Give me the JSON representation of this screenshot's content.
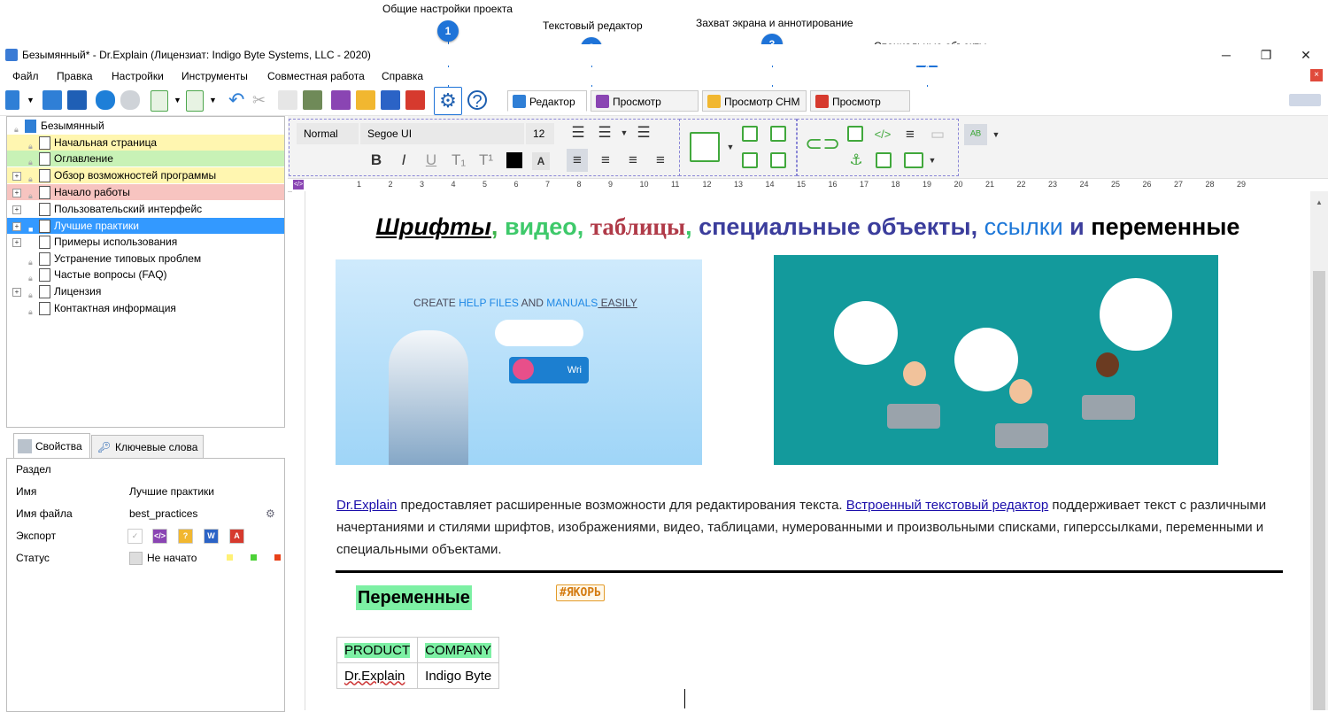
{
  "callouts": [
    {
      "num": "1",
      "text": "Общие настройки проекта"
    },
    {
      "num": "2",
      "text": "Текстовый редактор"
    },
    {
      "num": "3",
      "text": "Захват экрана и аннотирование"
    },
    {
      "num": "4",
      "text": "Специальные объекты"
    }
  ],
  "window": {
    "title": "Безымянный* - Dr.Explain (Лицензиат: Indigo Byte Systems, LLC - 2020)",
    "minimize": "─",
    "restore": "❐",
    "close": "✕"
  },
  "menu": [
    "Файл",
    "Правка",
    "Настройки",
    "Инструменты",
    "Совместная работа",
    "Справка"
  ],
  "menu_close": "×",
  "view_tabs": [
    "Редактор",
    "Просмотр HTML",
    "Просмотр CHM",
    "Просмотр PDF"
  ],
  "tree": {
    "root": "Безымянный",
    "items": [
      {
        "label": "Начальная страница",
        "bg": "#fff6b0"
      },
      {
        "label": "Оглавление",
        "bg": "#c8f2b6"
      },
      {
        "label": "Обзор возможностей программы",
        "bg": "#fff6b0"
      },
      {
        "label": "Начало работы",
        "bg": "#f7c4c0"
      },
      {
        "label": "Пользовательский интерфейс",
        "bg": "#ffffff"
      },
      {
        "label": "Лучшие практики",
        "bg": "#3399ff"
      },
      {
        "label": "Примеры использования",
        "bg": "#ffffff"
      },
      {
        "label": "Устранение типовых проблем",
        "bg": "#ffffff"
      },
      {
        "label": "Частые вопросы (FAQ)",
        "bg": "#ffffff"
      },
      {
        "label": "Лицензия",
        "bg": "#ffffff"
      },
      {
        "label": "Контактная информация",
        "bg": "#ffffff"
      }
    ]
  },
  "props": {
    "tabs": [
      "Свойства",
      "Ключевые слова"
    ],
    "section": "Раздел",
    "name_label": "Имя",
    "name_value": "Лучшие практики",
    "file_label": "Имя файла",
    "file_value": "best_practices",
    "export_label": "Экспорт",
    "status_label": "Статус",
    "status_value": "Не начато"
  },
  "editor": {
    "style": "Normal",
    "font": "Segoe UI",
    "size": "12"
  },
  "ruler_marks": [
    "1",
    "2",
    "3",
    "4",
    "5",
    "6",
    "7",
    "8",
    "9",
    "10",
    "11",
    "12",
    "13",
    "14",
    "15",
    "16",
    "17",
    "18",
    "19",
    "20",
    "21",
    "22",
    "23",
    "24",
    "25",
    "26",
    "27",
    "28",
    "29"
  ],
  "document": {
    "heading_parts": [
      {
        "text": "Шрифты",
        "color": "#000000"
      },
      {
        "text": ", ",
        "color": "#3cb44b"
      },
      {
        "text": "видео",
        "color": "#3ec96a"
      },
      {
        "text": ", ",
        "color": "#3ec96a"
      },
      {
        "text": "таблицы",
        "color": "#b03a48"
      },
      {
        "text": ", ",
        "color": "#3ec96a"
      },
      {
        "text": "специальные объекты",
        "color": "#3b3d9c"
      },
      {
        "text": ", ",
        "color": "#3b3d9c"
      },
      {
        "text": "ссылки",
        "color": "#1e78d8"
      },
      {
        "text": " и ",
        "color": "#3b3d9c"
      },
      {
        "text": "переменные",
        "color": "#000000"
      }
    ],
    "banner_left_text_1": "CREATE ",
    "banner_left_text_2": "HELP FILES",
    "banner_left_text_3": " AND ",
    "banner_left_text_4": "MANUALS",
    "banner_left_text_5": " EASILY",
    "banner_cup_text": "Wri",
    "para_link1": "Dr.Explain",
    "para_text1": " предоставляет расширенные возможности для редактирования текста. ",
    "para_link2": "Встроенный текстовый редактор",
    "para_text2": " поддерживает текст с различными начертаниями и стилями шрифтов, изображениями, видео, таблицами, нумерованными и произвольными списками, гиперссылками, переменными и специальными объектами.",
    "variables_heading": "Переменные",
    "anchor_tag": "#ЯКОРЬ",
    "table": {
      "headers": [
        "PRODUCT",
        "COMPANY"
      ],
      "values": [
        "Dr.Explain",
        "Indigo Byte"
      ]
    }
  },
  "colors": {
    "accent": "#1e73d8",
    "selection": "#3399ff",
    "variable_green": "#7df0a4"
  }
}
